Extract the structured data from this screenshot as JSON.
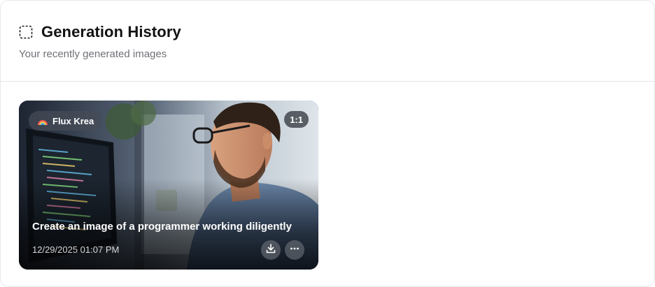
{
  "header": {
    "title": "Generation History",
    "subtitle": "Your recently generated images",
    "icon": "dashed-square-icon"
  },
  "history": [
    {
      "model": "Flux Krea",
      "model_icon": "rainbow-icon",
      "aspect_ratio": "1:1",
      "prompt": "Create an image of a programmer working diligently",
      "timestamp": "12/29/2025 01:07 PM",
      "actions": [
        "download-icon",
        "more-horizontal-icon"
      ]
    }
  ]
}
